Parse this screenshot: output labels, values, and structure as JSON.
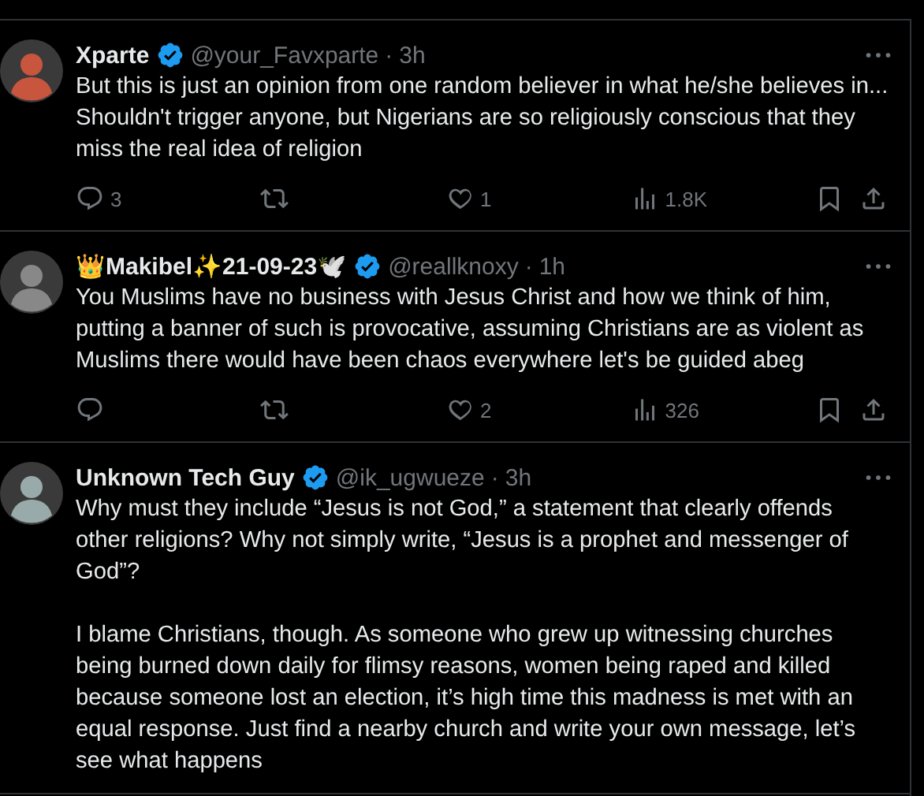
{
  "tweets": [
    {
      "name": "Xparte",
      "verified": true,
      "handle": "@your_Favxparte",
      "dot": "·",
      "time": "3h",
      "paragraphs": [
        "But this is just an opinion from one random believer in what he/she believes in... Shouldn't trigger anyone, but Nigerians are so religiously conscious that they miss the real idea of religion"
      ],
      "replies": "3",
      "likes": "1",
      "views": "1.8K"
    },
    {
      "name": "👑Makibel✨21-09-23🕊️",
      "verified": true,
      "handle": "@reallknoxy",
      "dot": "·",
      "time": "1h",
      "paragraphs": [
        "You Muslims have no business with Jesus Christ and how we think of him, putting a banner of such is provocative, assuming Christians are as violent as Muslims there would have been chaos everywhere let's be guided abeg"
      ],
      "likes": "2",
      "views": "326"
    },
    {
      "name": "Unknown Tech Guy",
      "verified": true,
      "handle": "@ik_ugwueze",
      "dot": "·",
      "time": "3h",
      "paragraphs": [
        "Why must they include “Jesus is not God,” a statement that clearly offends other religions? Why not simply write, “Jesus is a prophet and messenger of God”?",
        "I blame Christians, though. As someone who grew up witnessing churches being burned down daily for flimsy reasons, women being raped and killed because someone lost an election, it’s high time this madness is met with an equal response. Just find a nearby church and write your own message, let’s see what happens"
      ]
    }
  ]
}
